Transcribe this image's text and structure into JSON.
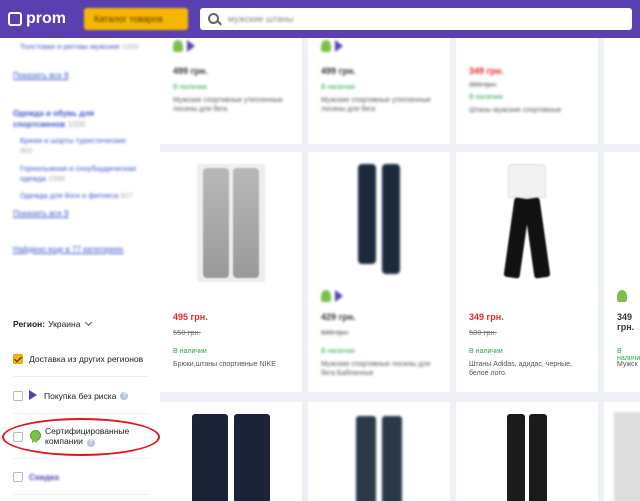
{
  "header": {
    "logo": "prom",
    "catalog_button": "Каталог товаров",
    "search_placeholder": "мужские штаны"
  },
  "sidebar": {
    "top_item": {
      "label": "Толстовки и реглаы мужские",
      "count": "1000"
    },
    "show_all_1": "Показать все 8",
    "sport_heading": "Одежда и обувь для спортсменов",
    "sport_count": "1000",
    "sub_items": [
      {
        "label": "Брюки и шорты туристические",
        "count": "900"
      },
      {
        "label": "Горнолыжная и сноубордическая одежда",
        "count": "1999"
      },
      {
        "label": "Одежда для йоги и фитнеса",
        "count": "827"
      }
    ],
    "show_all_2": "Показать все 9",
    "found_more": "Найдено еще в 77 категориях",
    "region_label": "Регион:",
    "region_value": "Украина",
    "filters": {
      "delivery": "Доставка из других регионов",
      "safe_purchase": "Покупка без риска",
      "certified_line1": "Сертифицированные",
      "certified_line2": "компании",
      "help_mark": "?",
      "discount": "Скидка"
    }
  },
  "products": [
    {
      "price": "499 грн.",
      "availability": "В наличии",
      "title": "Мужские спортивные утепленные лосины для бега"
    },
    {
      "price": "499 грн.",
      "availability": "В наличии",
      "title": "Мужские спортивные утепленные лосины для бега"
    },
    {
      "price": "349 грн.",
      "old_price": "399 грн.",
      "availability": "В наличии",
      "title": "Штаны мужские спортивные"
    },
    {
      "price": "495 грн.",
      "old_price": "550 грн.",
      "availability": "В наличии",
      "title": "Брюки,штаны спортивные NIKE"
    },
    {
      "price": "429 грн.",
      "old_price": "500 грн.",
      "availability": "В наличии",
      "title": "Мужские спортивные лосины для бега Баблачные"
    },
    {
      "price": "349 грн.",
      "old_price": "500 грн.",
      "availability": "В наличии",
      "title": "Штаны Adidas, адидас, черные, белое лого."
    },
    {
      "price": "349 грн.",
      "availability": "В наличии",
      "title": "Мужск"
    }
  ],
  "colors": {
    "header_bg": "#5a3fb0",
    "catalog_button": "#f5b700",
    "link": "#3a56c8",
    "price_sale": "#e02b2b",
    "in_stock": "#2fa84f",
    "highlight": "#e0141e"
  }
}
